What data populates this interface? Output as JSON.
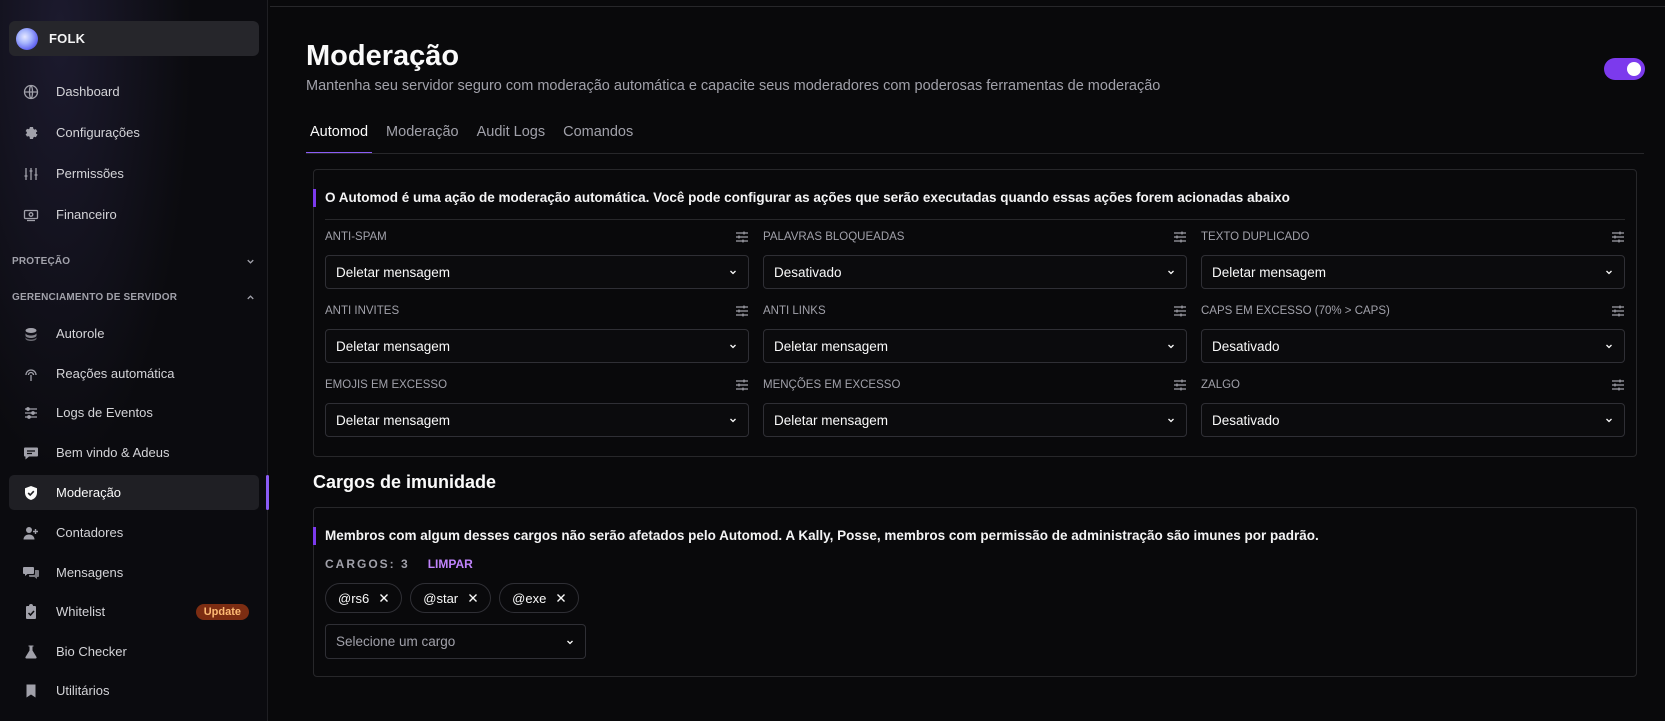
{
  "server": {
    "name": "FOLK"
  },
  "sidebar": {
    "top_items": [
      {
        "label": "Dashboard",
        "icon": "globe-icon"
      },
      {
        "label": "Configurações",
        "icon": "gear-icon"
      },
      {
        "label": "Permissões",
        "icon": "sliders-icon"
      },
      {
        "label": "Financeiro",
        "icon": "money-icon"
      }
    ],
    "sections": [
      {
        "label": "PROTEÇÃO",
        "expanded": false
      },
      {
        "label": "GERENCIAMENTO DE SERVIDOR",
        "expanded": true
      }
    ],
    "server_items": [
      {
        "label": "Autorole",
        "icon": "roles-icon"
      },
      {
        "label": "Reações automática",
        "icon": "reaction-icon"
      },
      {
        "label": "Logs de Eventos",
        "icon": "log-icon"
      },
      {
        "label": "Bem vindo & Adeus",
        "icon": "chat-icon"
      },
      {
        "label": "Moderação",
        "icon": "shield-icon",
        "active": true
      },
      {
        "label": "Contadores",
        "icon": "user-plus-icon"
      },
      {
        "label": "Mensagens",
        "icon": "messages-icon"
      },
      {
        "label": "Whitelist",
        "icon": "clipboard-icon",
        "badge": "Update"
      },
      {
        "label": "Bio Checker",
        "icon": "flask-icon"
      },
      {
        "label": "Utilitários",
        "icon": "bookmark-icon"
      }
    ]
  },
  "header": {
    "title": "Moderação",
    "subtitle": "Mantenha seu servidor seguro com moderação automática e capacite seus moderadores com poderosas ferramentas de moderação",
    "enabled": true
  },
  "tabs": [
    {
      "label": "Automod",
      "active": true
    },
    {
      "label": "Moderação",
      "active": false
    },
    {
      "label": "Audit Logs",
      "active": false
    },
    {
      "label": "Comandos",
      "active": false
    }
  ],
  "automod": {
    "description": "O Automod é uma ação de moderação automática. Você pode configurar as ações que serão executadas quando essas ações forem acionadas abaixo",
    "fields": [
      {
        "label": "ANTI-SPAM",
        "value": "Deletar mensagem"
      },
      {
        "label": "PALAVRAS BLOQUEADAS",
        "value": "Desativado"
      },
      {
        "label": "TEXTO DUPLICADO",
        "value": "Deletar mensagem"
      },
      {
        "label": "ANTI INVITES",
        "value": "Deletar mensagem"
      },
      {
        "label": "ANTI LINKS",
        "value": "Deletar mensagem"
      },
      {
        "label": "CAPS EM EXCESSO (70% > CAPS)",
        "value": "Desativado"
      },
      {
        "label": "EMOJIS EM EXCESSO",
        "value": "Deletar mensagem"
      },
      {
        "label": "MENÇÕES EM EXCESSO",
        "value": "Deletar mensagem"
      },
      {
        "label": "ZALGO",
        "value": "Desativado"
      }
    ]
  },
  "immunity": {
    "heading": "Cargos de imunidade",
    "description": "Membros com algum desses cargos não serão afetados pelo Automod. A Kally, Posse, membros com permissão de administração são imunes por padrão.",
    "count_label": "CARGOS: 3",
    "clear_label": "LIMPAR",
    "roles": [
      "@rs6",
      "@star",
      "@exe"
    ],
    "select_placeholder": "Selecione um cargo"
  },
  "colors": {
    "accent": "#7c3aed",
    "badge_bg": "#7c2d12",
    "badge_text": "#fdba74",
    "link": "#c084fc"
  }
}
